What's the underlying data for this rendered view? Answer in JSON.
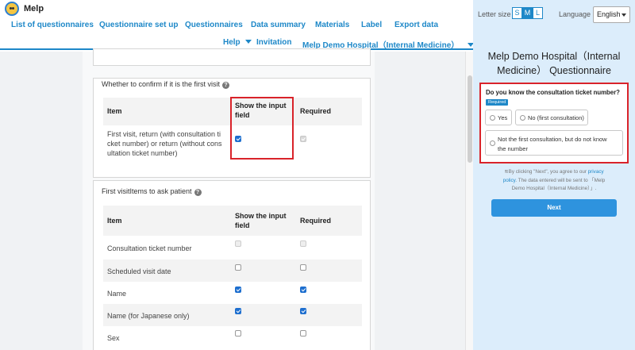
{
  "header": {
    "brand": "Melp",
    "nav_row1": [
      "List of questionnaires",
      "Questionnaire set up",
      "Questionnaires",
      "Data summary",
      "Materials",
      "Label",
      "Export data"
    ],
    "nav_help": "Help",
    "nav_invitation": "Invitation",
    "nav_hospital": "Melp Demo Hospital（Internal Medicine）"
  },
  "first_visit_card": {
    "title": "Whether to confirm if it is the first visit",
    "col_item": "Item",
    "col_show_line1": "Show the input",
    "col_show_line2": "field",
    "col_required": "Required",
    "row_label_lines": [
      "First visit, return (with consultation ti",
      "cket number) or return (without cons",
      "ultation ticket number)"
    ],
    "row_show_checked": true,
    "row_required_checked": true
  },
  "patient_items_card": {
    "title": "First visitItems to ask patient",
    "col_item": "Item",
    "col_show_line1": "Show the input",
    "col_show_line2": "field",
    "col_required": "Required",
    "rows": [
      {
        "label": "Consultation ticket number",
        "show": false,
        "required": false
      },
      {
        "label": "Scheduled visit date",
        "show": false,
        "required": false
      },
      {
        "label": "Name",
        "show": true,
        "required": true
      },
      {
        "label": "Name (for Japanese only)",
        "show": true,
        "required": true
      },
      {
        "label": "Sex",
        "show": false,
        "required": false
      }
    ]
  },
  "preview": {
    "letter_size_label": "Letter size",
    "sizes": [
      "S",
      "M",
      "L"
    ],
    "selected_size": "M",
    "language_label": "Language",
    "language_value": "English",
    "title_line1": "Melp Demo Hospital（Internal",
    "title_line2": "Medicine） Questionnaire",
    "question": "Do you know the consultation ticket number?",
    "required_badge": "Required",
    "options": [
      "Yes",
      "No (first consultation)",
      "Not the first consultation, but do not know the number"
    ],
    "option3_line1": "Not the first consultation, but do not know",
    "option3_line2": "the number",
    "consent_pre": "≋By clicking \"Next\", you agree to our ",
    "consent_link": "privacy",
    "consent_line2_link": "policy",
    "consent_line2_rest": ". The data entered will be sent to 「Melp",
    "consent_line3": "Demo Hospital（Internal Medicine）」.",
    "next_label": "Next"
  },
  "colors": {
    "accent": "#1e88c8",
    "highlight": "#d9232a",
    "preview_bg": "#dcedfb",
    "next_button": "#2e93de"
  }
}
